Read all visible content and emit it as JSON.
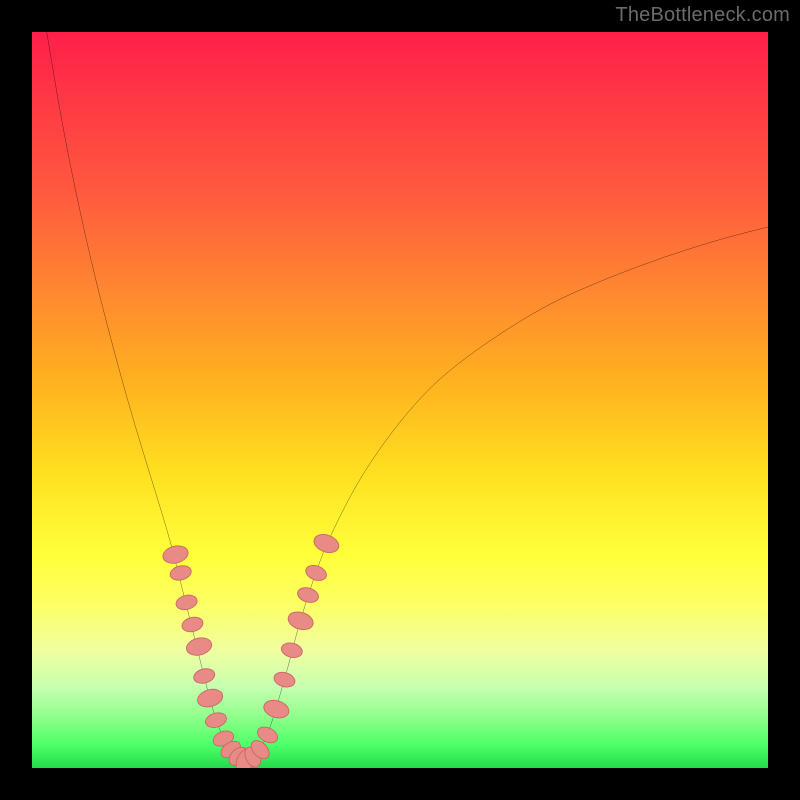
{
  "watermark": "TheBottleneck.com",
  "colors": {
    "black": "#000000",
    "curve": "#000000",
    "marker_fill": "#e88a86",
    "marker_stroke": "#c96662",
    "gradient_top": "#ff1f4a",
    "gradient_bottom": "#24d94d"
  },
  "chart_data": {
    "type": "line",
    "title": "",
    "xlabel": "",
    "ylabel": "",
    "xlim": [
      0,
      100
    ],
    "ylim": [
      0,
      100
    ],
    "curve_left": {
      "name": "left-branch",
      "points": [
        {
          "x": 2.0,
          "y": 100.0
        },
        {
          "x": 4.0,
          "y": 88.0
        },
        {
          "x": 6.0,
          "y": 78.0
        },
        {
          "x": 8.0,
          "y": 69.0
        },
        {
          "x": 10.0,
          "y": 61.0
        },
        {
          "x": 12.0,
          "y": 53.5
        },
        {
          "x": 14.0,
          "y": 46.5
        },
        {
          "x": 16.0,
          "y": 40.0
        },
        {
          "x": 18.0,
          "y": 33.5
        },
        {
          "x": 19.0,
          "y": 30.0
        },
        {
          "x": 20.0,
          "y": 26.0
        },
        {
          "x": 21.0,
          "y": 22.0
        },
        {
          "x": 22.0,
          "y": 18.0
        },
        {
          "x": 23.0,
          "y": 14.0
        },
        {
          "x": 24.0,
          "y": 10.0
        },
        {
          "x": 25.0,
          "y": 6.5
        },
        {
          "x": 26.0,
          "y": 4.0
        },
        {
          "x": 27.0,
          "y": 2.5
        },
        {
          "x": 28.0,
          "y": 1.5
        },
        {
          "x": 29.0,
          "y": 1.0
        }
      ]
    },
    "curve_right": {
      "name": "right-branch",
      "points": [
        {
          "x": 29.0,
          "y": 1.0
        },
        {
          "x": 30.0,
          "y": 1.5
        },
        {
          "x": 31.0,
          "y": 2.5
        },
        {
          "x": 32.0,
          "y": 4.5
        },
        {
          "x": 33.0,
          "y": 7.5
        },
        {
          "x": 34.0,
          "y": 11.0
        },
        {
          "x": 35.0,
          "y": 14.5
        },
        {
          "x": 36.0,
          "y": 18.5
        },
        {
          "x": 38.0,
          "y": 25.0
        },
        {
          "x": 40.0,
          "y": 30.5
        },
        {
          "x": 44.0,
          "y": 38.5
        },
        {
          "x": 48.0,
          "y": 44.5
        },
        {
          "x": 52.0,
          "y": 49.5
        },
        {
          "x": 56.0,
          "y": 53.5
        },
        {
          "x": 62.0,
          "y": 58.0
        },
        {
          "x": 70.0,
          "y": 63.0
        },
        {
          "x": 78.0,
          "y": 66.5
        },
        {
          "x": 86.0,
          "y": 69.5
        },
        {
          "x": 94.0,
          "y": 72.0
        },
        {
          "x": 100.0,
          "y": 73.5
        }
      ]
    },
    "markers": [
      {
        "x": 19.5,
        "y": 29.0,
        "r": 1.2
      },
      {
        "x": 20.2,
        "y": 26.5,
        "r": 1.0
      },
      {
        "x": 21.0,
        "y": 22.5,
        "r": 1.0
      },
      {
        "x": 21.8,
        "y": 19.5,
        "r": 1.0
      },
      {
        "x": 22.7,
        "y": 16.5,
        "r": 1.2
      },
      {
        "x": 23.4,
        "y": 12.5,
        "r": 1.0
      },
      {
        "x": 24.2,
        "y": 9.5,
        "r": 1.2
      },
      {
        "x": 25.0,
        "y": 6.5,
        "r": 1.0
      },
      {
        "x": 26.0,
        "y": 4.0,
        "r": 1.0
      },
      {
        "x": 27.0,
        "y": 2.5,
        "r": 1.0
      },
      {
        "x": 28.0,
        "y": 1.6,
        "r": 1.0
      },
      {
        "x": 29.0,
        "y": 1.0,
        "r": 1.2
      },
      {
        "x": 30.0,
        "y": 1.5,
        "r": 1.0
      },
      {
        "x": 31.0,
        "y": 2.5,
        "r": 1.0
      },
      {
        "x": 32.0,
        "y": 4.5,
        "r": 1.0
      },
      {
        "x": 33.2,
        "y": 8.0,
        "r": 1.2
      },
      {
        "x": 34.3,
        "y": 12.0,
        "r": 1.0
      },
      {
        "x": 35.3,
        "y": 16.0,
        "r": 1.0
      },
      {
        "x": 36.5,
        "y": 20.0,
        "r": 1.2
      },
      {
        "x": 37.5,
        "y": 23.5,
        "r": 1.0
      },
      {
        "x": 38.6,
        "y": 26.5,
        "r": 1.0
      },
      {
        "x": 40.0,
        "y": 30.5,
        "r": 1.2
      }
    ]
  }
}
